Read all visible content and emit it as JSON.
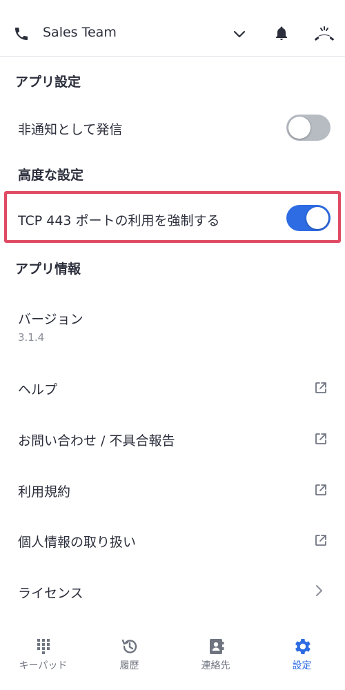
{
  "header": {
    "team_name": "Sales Team",
    "phone_icon": "phone-icon",
    "dropdown_icon": "chevron-down-icon",
    "bell_icon": "bell-icon",
    "hangup_icon": "hangup-icon"
  },
  "app_settings": {
    "title": "アプリ設定",
    "hide_caller_id": {
      "label": "非通知として発信",
      "enabled": false
    }
  },
  "advanced_settings": {
    "title": "高度な設定",
    "force_tcp443": {
      "label": "TCP 443 ポートの利用を強制する",
      "enabled": true
    }
  },
  "app_info": {
    "title": "アプリ情報",
    "version_label": "バージョン",
    "version_value": "3.1.4",
    "items": [
      {
        "label": "ヘルプ",
        "icon": "external-link-icon"
      },
      {
        "label": "お問い合わせ / 不具合報告",
        "icon": "external-link-icon"
      },
      {
        "label": "利用規約",
        "icon": "external-link-icon"
      },
      {
        "label": "個人情報の取り扱い",
        "icon": "external-link-icon"
      },
      {
        "label": "ライセンス",
        "icon": "chevron-right-icon"
      }
    ]
  },
  "tabs": [
    {
      "label": "キーパッド",
      "icon": "keypad-icon",
      "active": false
    },
    {
      "label": "履歴",
      "icon": "history-icon",
      "active": false
    },
    {
      "label": "連絡先",
      "icon": "contacts-icon",
      "active": false
    },
    {
      "label": "設定",
      "icon": "gear-icon",
      "active": true
    }
  ],
  "colors": {
    "accent": "#2d6ce3",
    "highlight_border": "#e04a63",
    "toggle_off": "#b7bcc3",
    "text": "#2b2e3b",
    "icon_gray": "#6f7480"
  }
}
